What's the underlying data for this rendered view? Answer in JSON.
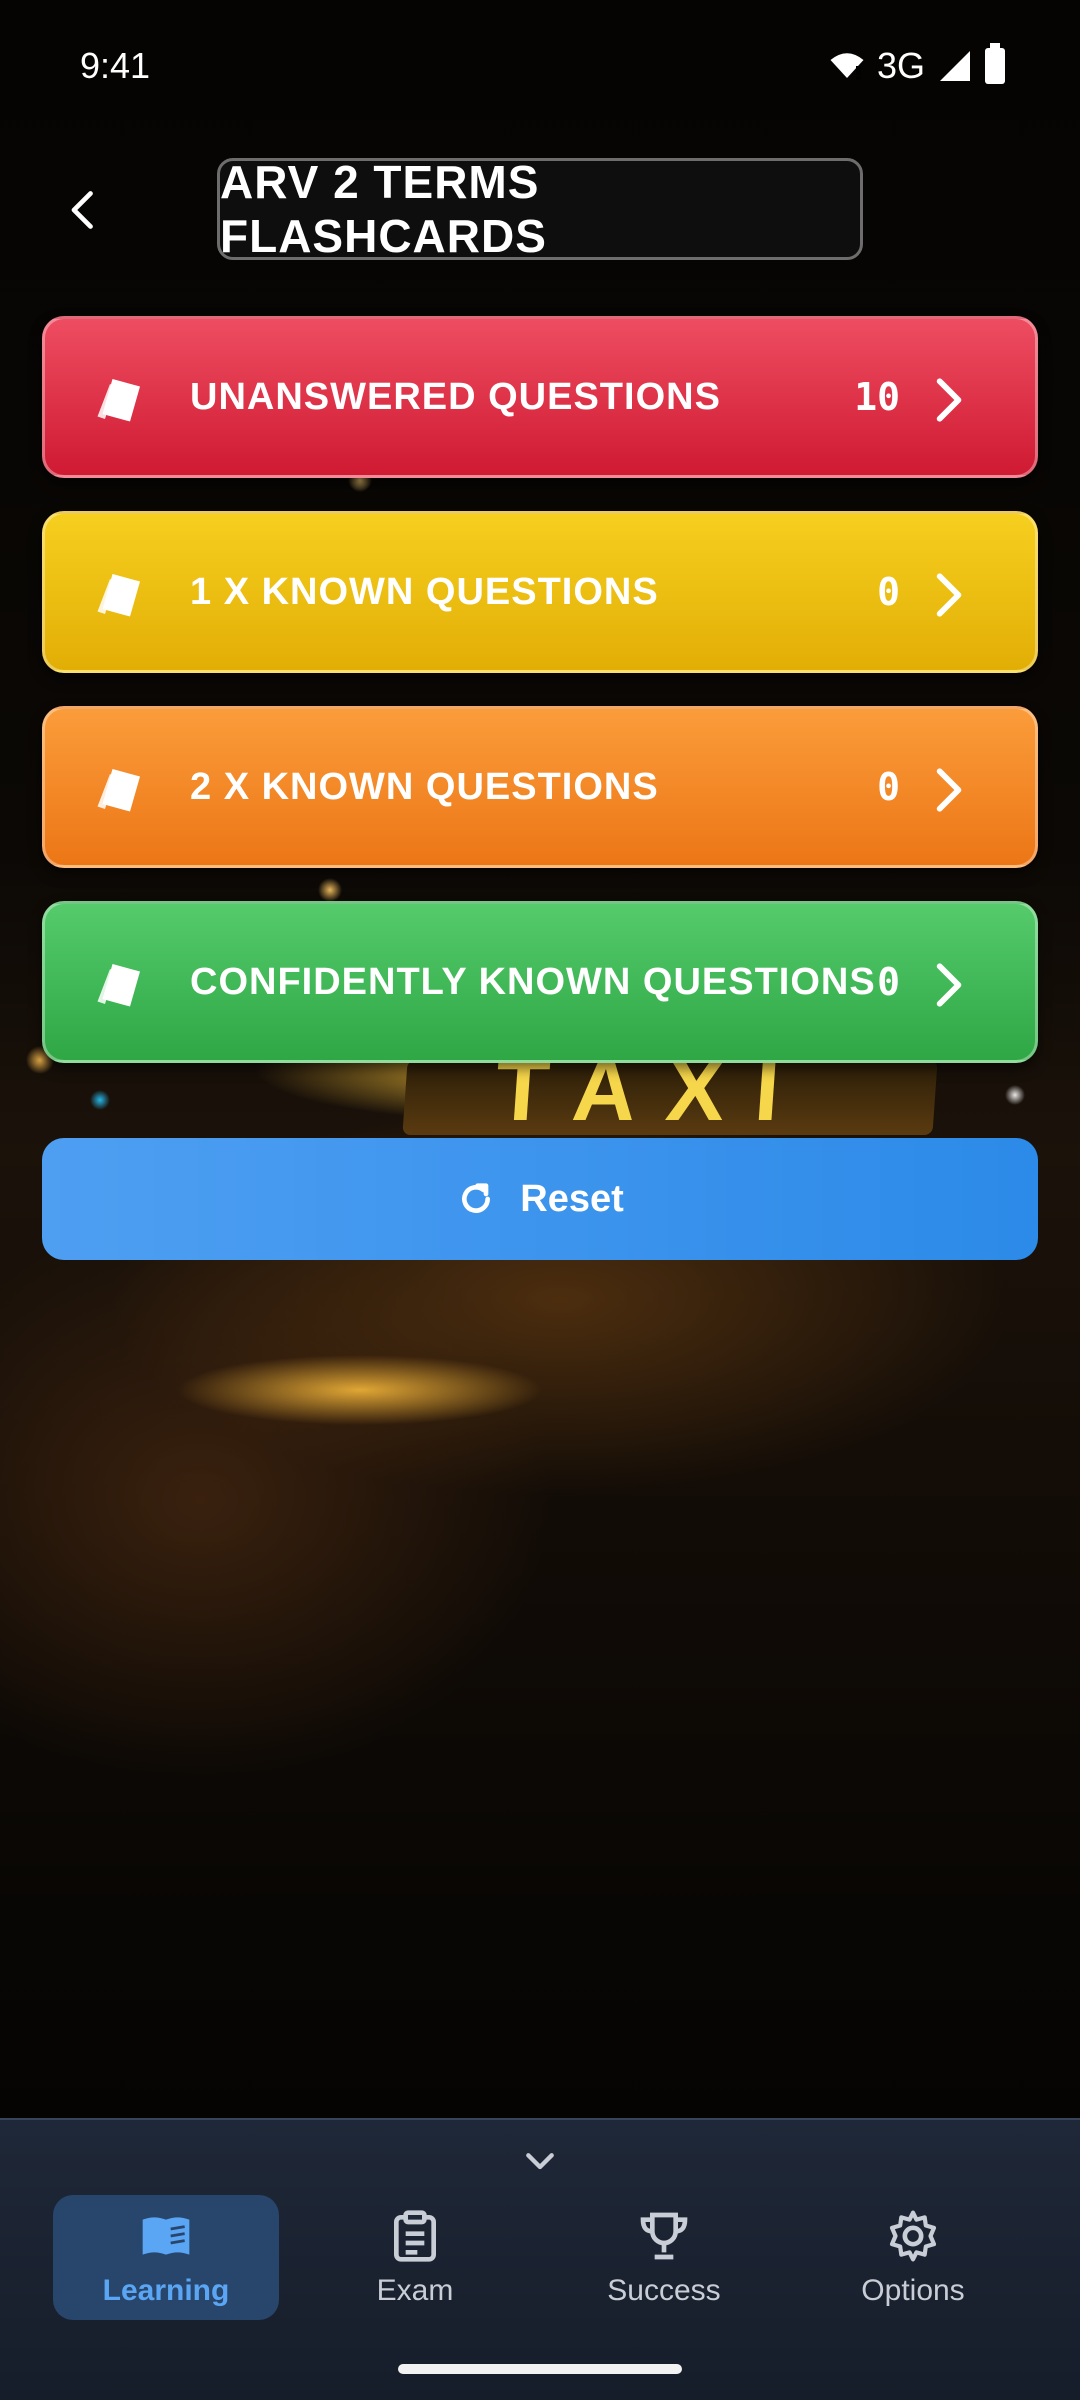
{
  "status_bar": {
    "time": "9:41",
    "network": "3G"
  },
  "header": {
    "title": "ARV 2 TERMS FLASHCARDS",
    "back_icon": "chevron-left-icon"
  },
  "categories": [
    {
      "label": "UNANSWERED QUESTIONS",
      "count": "10",
      "color": "#DC2A40",
      "icon": "flashcards-icon"
    },
    {
      "label": "1 X KNOWN QUESTIONS",
      "count": "0",
      "color": "#EDBE10",
      "icon": "flashcards-icon"
    },
    {
      "label": "2 X KNOWN QUESTIONS",
      "count": "0",
      "color": "#F48828",
      "icon": "flashcards-icon"
    },
    {
      "label": "CONFIDENTLY KNOWN QUESTIONS",
      "count": "0",
      "color": "#42B858",
      "icon": "flashcards-icon"
    }
  ],
  "reset": {
    "label": "Reset",
    "icon": "refresh-icon",
    "color": "#3D95EE"
  },
  "bottom_nav": {
    "tabs": [
      {
        "label": "Learning",
        "icon": "book-icon",
        "active": true
      },
      {
        "label": "Exam",
        "icon": "clipboard-icon",
        "active": false
      },
      {
        "label": "Success",
        "icon": "trophy-icon",
        "active": false
      },
      {
        "label": "Options",
        "icon": "gear-icon",
        "active": false
      }
    ],
    "active_color": "#5AA6F4"
  }
}
